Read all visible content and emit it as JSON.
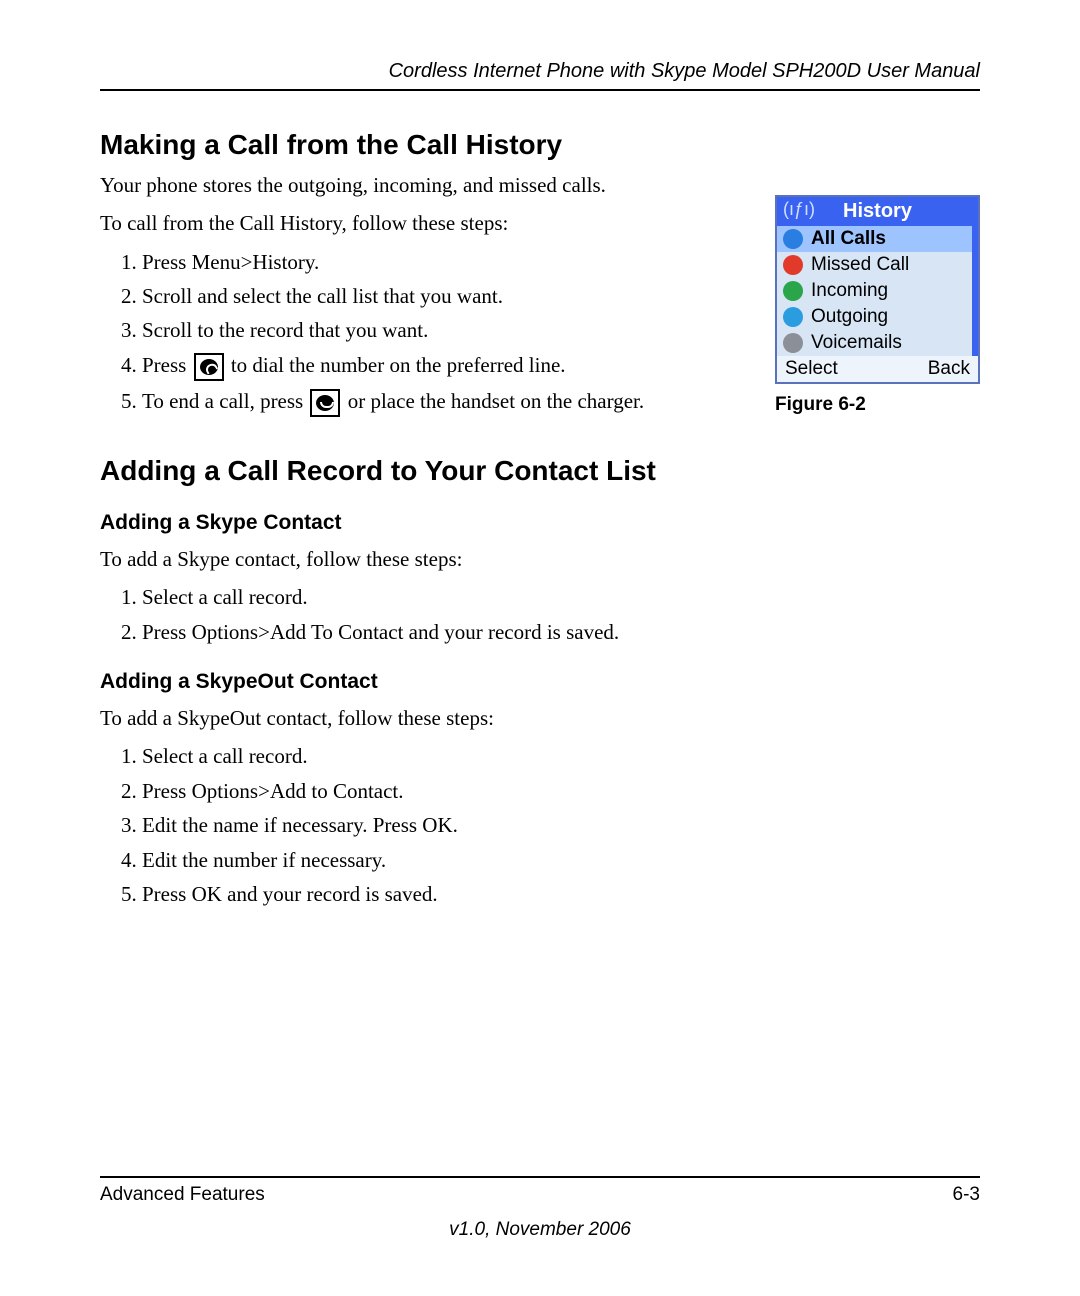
{
  "header": {
    "running_title": "Cordless Internet Phone with Skype Model SPH200D User Manual"
  },
  "section1": {
    "title": "Making a Call from the Call History",
    "intro1": "Your phone stores the outgoing, incoming, and missed calls.",
    "intro2": "To call from the Call History, follow these steps:",
    "steps": [
      "Press Menu>History.",
      "Scroll and select the call list that you want.",
      "Scroll to the record that you want.",
      "Press  [call]  to dial the number on the preferred line.",
      "To end a call, press  [end]  or place the handset on the charger."
    ],
    "step4_pre": "Press ",
    "step4_post": " to dial the number on the preferred line.",
    "step5_pre": "To end a call, press ",
    "step5_post": " or place the handset on the charger."
  },
  "figure": {
    "title": "History",
    "items": [
      {
        "label": "All Calls",
        "icon": "blue",
        "selected": true
      },
      {
        "label": "Missed Call",
        "icon": "red",
        "selected": false
      },
      {
        "label": "Incoming",
        "icon": "green",
        "selected": false
      },
      {
        "label": "Outgoing",
        "icon": "cyan",
        "selected": false
      },
      {
        "label": "Voicemails",
        "icon": "grey",
        "selected": false
      }
    ],
    "soft_left": "Select",
    "soft_right": "Back",
    "caption": "Figure 6-2"
  },
  "section2": {
    "title": "Adding a Call Record to Your Contact List",
    "sub1": {
      "title": "Adding a Skype Contact",
      "intro": "To add a Skype contact, follow these steps:",
      "steps": [
        "Select a call record.",
        "Press Options>Add To Contact and your record is saved."
      ]
    },
    "sub2": {
      "title": "Adding a SkypeOut Contact",
      "intro": "To add a SkypeOut contact, follow these steps:",
      "steps": [
        "Select a call record.",
        "Press Options>Add to Contact.",
        "Edit the name if necessary. Press OK.",
        "Edit the number if necessary.",
        "Press OK and your record is saved."
      ]
    }
  },
  "footer": {
    "left": "Advanced Features",
    "right": "6-3",
    "version": "v1.0, November 2006"
  }
}
